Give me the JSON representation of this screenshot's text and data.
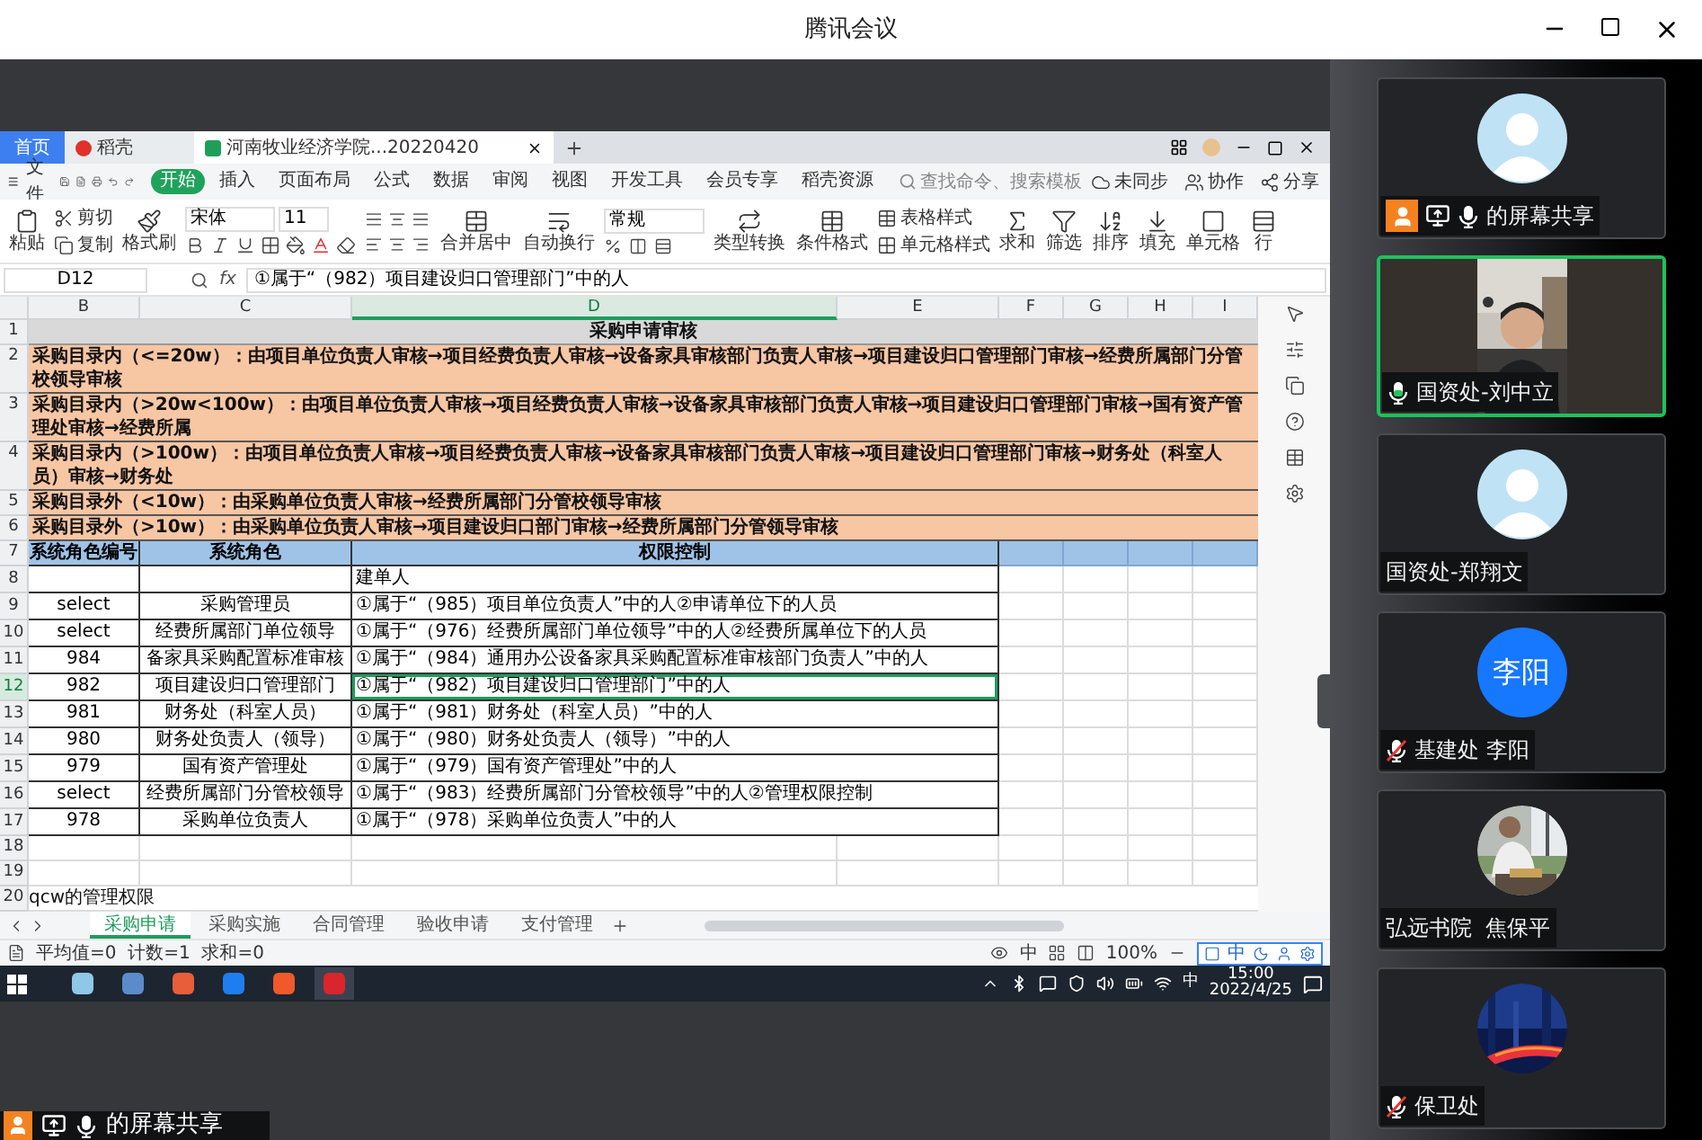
{
  "window": {
    "title": "腾讯会议"
  },
  "shared_screen": {
    "app_tabs": [
      {
        "label": "首页",
        "kind": "home",
        "selected": false
      },
      {
        "label": "稻壳",
        "kind": "docer",
        "selected": false
      },
      {
        "label": "河南牧业经济学院...20220420",
        "kind": "sheet",
        "selected": true
      }
    ],
    "file_menu": "文件",
    "ribbon_tabs": [
      {
        "label": "开始",
        "selected": true
      },
      {
        "label": "插入",
        "selected": false
      },
      {
        "label": "页面布局",
        "selected": false
      },
      {
        "label": "公式",
        "selected": false
      },
      {
        "label": "数据",
        "selected": false
      },
      {
        "label": "审阅",
        "selected": false
      },
      {
        "label": "视图",
        "selected": false
      },
      {
        "label": "开发工具",
        "selected": false
      },
      {
        "label": "会员专享",
        "selected": false
      },
      {
        "label": "稻壳资源",
        "selected": false
      }
    ],
    "search": {
      "placeholder": "查找命令、搜索模板"
    },
    "sync": "未同步",
    "collaborate": "协作",
    "share": "分享",
    "toolbar": {
      "paste": "粘贴",
      "cut": "剪切",
      "copy": "复制",
      "format_painter": "格式刷",
      "font": "宋体",
      "font_size": "11",
      "merge": "合并居中",
      "wrap": "自动换行",
      "number_format": "常规",
      "convert": "类型转换",
      "conditional_format": "条件格式",
      "table_style": "表格样式",
      "cell_style": "单元格样式",
      "sum": "求和",
      "filter": "筛选",
      "sort": "排序",
      "fill": "填充",
      "cell": "单元格",
      "row": "行"
    },
    "name_box": "D12",
    "function_label": "fx",
    "formula": "①属于“（982）项目建设归口管理部门”中的人",
    "columns": [
      {
        "label": "B",
        "selected": false
      },
      {
        "label": "C",
        "selected": false
      },
      {
        "label": "D",
        "selected": true
      },
      {
        "label": "E",
        "selected": false
      },
      {
        "label": "F",
        "selected": false
      },
      {
        "label": "G",
        "selected": false
      },
      {
        "label": "H",
        "selected": false
      },
      {
        "label": "I",
        "selected": false
      }
    ],
    "rows": [
      {
        "number": "1",
        "kind": "title",
        "text": "采购申请审核"
      },
      {
        "number": "2",
        "kind": "flow",
        "text": "采购目录内（<=20w）：由项目单位负责人审核→项目经费负责人审核→设备家具审核部门负责人审核→项目建设归口管理部门审核→经费所属部门分管校领导审核"
      },
      {
        "number": "3",
        "kind": "flow",
        "text": "采购目录内（>20w<100w）：由项目单位负责人审核→项目经费负责人审核→设备家具审核部门负责人审核→项目建设归口管理部门审核→国有资产管理处审核→经费所属"
      },
      {
        "number": "4",
        "kind": "flow",
        "text": "采购目录内（>100w）：由项目单位负责人审核→项目经费负责人审核→设备家具审核部门负责人审核→项目建设归口管理部门审核→财务处（科室人员）审核→财务处"
      },
      {
        "number": "5",
        "kind": "flow",
        "text": "采购目录外（<10w）：由采购单位负责人审核→经费所属部门分管校领导审核"
      },
      {
        "number": "6",
        "kind": "flow",
        "text": "采购目录外（>10w）：由采购单位负责人审核→项目建设归口部门审核→经费所属部门分管领导审核"
      },
      {
        "number": "7",
        "kind": "header",
        "role_id": "系统角色编号",
        "role": "系统角色",
        "permission": "权限控制"
      },
      {
        "number": "8",
        "kind": "data",
        "selected": false,
        "permission": "建单人"
      },
      {
        "number": "9",
        "kind": "data",
        "selected": false,
        "role_id": "select",
        "role": "采购管理员",
        "permission": "①属于“（985）项目单位负责人”中的人②申请单位下的人员"
      },
      {
        "number": "10",
        "kind": "data",
        "selected": false,
        "role_id": "select",
        "role": "经费所属部门单位领导",
        "permission": "①属于“（976）经费所属部门单位领导”中的人②经费所属单位下的人员"
      },
      {
        "number": "11",
        "kind": "data",
        "selected": false,
        "role_id": "984",
        "role": "备家具采购配置标准审核",
        "permission": "①属于“（984）通用办公设备家具采购配置标准审核部门负责人”中的人"
      },
      {
        "number": "12",
        "kind": "data",
        "selected": true,
        "role_id": "982",
        "role": "项目建设归口管理部门",
        "permission": "①属于“（982）项目建设归口管理部门”中的人"
      },
      {
        "number": "13",
        "kind": "data",
        "selected": false,
        "role_id": "981",
        "role": "财务处（科室人员）",
        "permission": "①属于“（981）财务处（科室人员）”中的人"
      },
      {
        "number": "14",
        "kind": "data",
        "selected": false,
        "role_id": "980",
        "role": "财务处负责人（领导）",
        "permission": "①属于“（980）财务处负责人（领导）”中的人"
      },
      {
        "number": "15",
        "kind": "data",
        "selected": false,
        "role_id": "979",
        "role": "国有资产管理处",
        "permission": "①属于“（979）国有资产管理处”中的人"
      },
      {
        "number": "16",
        "kind": "data",
        "selected": false,
        "role_id": "select",
        "role": "经费所属部门分管校领导",
        "permission": "①属于“（983）经费所属部门分管校领导”中的人②管理权限控制"
      },
      {
        "number": "17",
        "kind": "data",
        "selected": false,
        "role_id": "978",
        "role": "采购单位负责人",
        "permission": "①属于“（978）采购单位负责人”中的人"
      },
      {
        "number": "18",
        "kind": "blank"
      },
      {
        "number": "19",
        "kind": "blank"
      },
      {
        "number": "20",
        "kind": "note",
        "text": "qcw的管理权限"
      }
    ],
    "sheet_tabs": [
      {
        "label": "采购申请",
        "selected": true
      },
      {
        "label": "采购实施",
        "selected": false
      },
      {
        "label": "合同管理",
        "selected": false
      },
      {
        "label": "验收申请",
        "selected": false
      },
      {
        "label": "支付管理",
        "selected": false
      }
    ],
    "status": {
      "summary": "平均值=0  计数=1  求和=0",
      "input_mode": "中",
      "zoom": "100%",
      "ime": "中"
    }
  },
  "taskbar": {
    "ime": "中",
    "time": "15:00",
    "date": "2022/4/25"
  },
  "participants": [
    {
      "name": "的屏幕共享",
      "kind": "avatar",
      "presenter": true,
      "mic_icon": true,
      "muted": false,
      "speaking": false,
      "active": false
    },
    {
      "name": "国资处-刘中立",
      "kind": "video",
      "presenter": false,
      "mic_icon": true,
      "muted": false,
      "speaking": true,
      "active": true
    },
    {
      "name": "国资处-郑翔文",
      "kind": "avatar",
      "presenter": false,
      "mic_icon": false,
      "muted": false,
      "speaking": false,
      "active": false
    },
    {
      "name": "基建处 李阳",
      "kind": "initials",
      "avatar_text": "李阳",
      "presenter": false,
      "mic_icon": true,
      "muted": true,
      "speaking": false,
      "active": false
    },
    {
      "name": "弘远书院  焦保平",
      "presenter": false,
      "mic_icon": false,
      "muted": false,
      "speaking": false,
      "active": false
    },
    {
      "name": "保卫处",
      "presenter": false,
      "mic_icon": true,
      "muted": true,
      "speaking": false,
      "active": false
    }
  ],
  "presenter_bar": {
    "label": "的屏幕共享"
  }
}
